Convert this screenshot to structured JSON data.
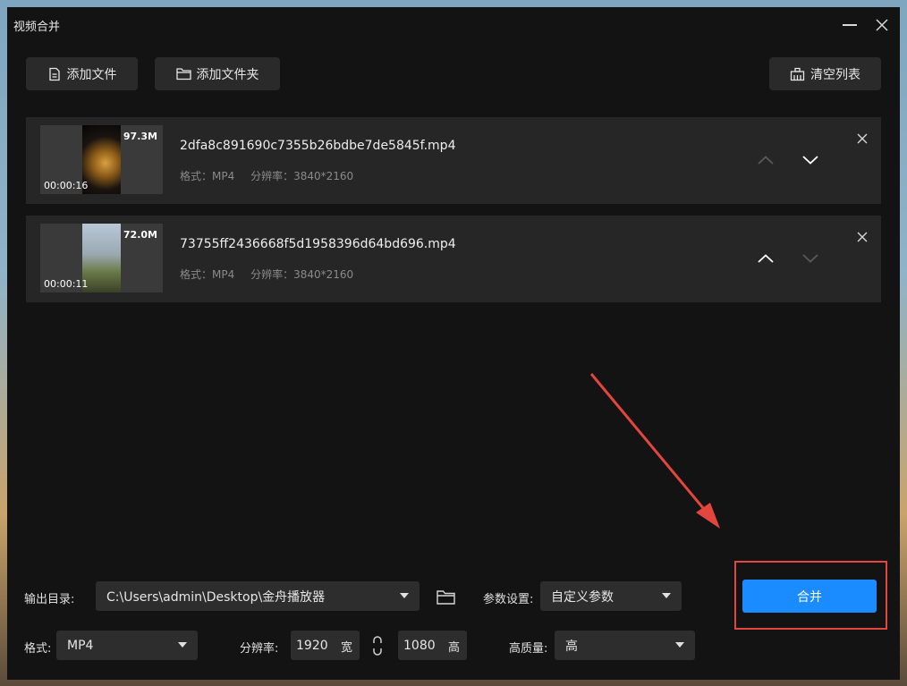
{
  "window": {
    "title": "视频合并"
  },
  "toolbar": {
    "add_file": "添加文件",
    "add_folder": "添加文件夹",
    "clear_list": "清空列表"
  },
  "files": [
    {
      "name": "2dfa8c891690c7355b26bdbe7de5845f.mp4",
      "size": "97.3M",
      "duration": "00:00:16",
      "format": "格式：MP4",
      "resolution": "分辨率：3840*2160",
      "up_enabled": false,
      "down_enabled": true
    },
    {
      "name": "73755ff2436668f5d1958396d64bd696.mp4",
      "size": "72.0M",
      "duration": "00:00:11",
      "format": "格式：MP4",
      "resolution": "分辨率：3840*2160",
      "up_enabled": true,
      "down_enabled": false
    }
  ],
  "output": {
    "dir_label": "输出目录:",
    "dir_value": "C:\\Users\\admin\\Desktop\\金舟播放器",
    "params_label": "参数设置:",
    "params_value": "自定义参数",
    "format_label": "格式:",
    "format_value": "MP4",
    "resolution_label": "分辨率:",
    "width_value": "1920",
    "width_unit": "宽",
    "height_value": "1080",
    "height_unit": "高",
    "quality_label": "高质量:",
    "quality_value": "高"
  },
  "merge_button": "合并",
  "colors": {
    "window_bg": "#131313",
    "item_bg": "#262626",
    "accent": "#1a8cff",
    "annotation": "#e2463c"
  }
}
